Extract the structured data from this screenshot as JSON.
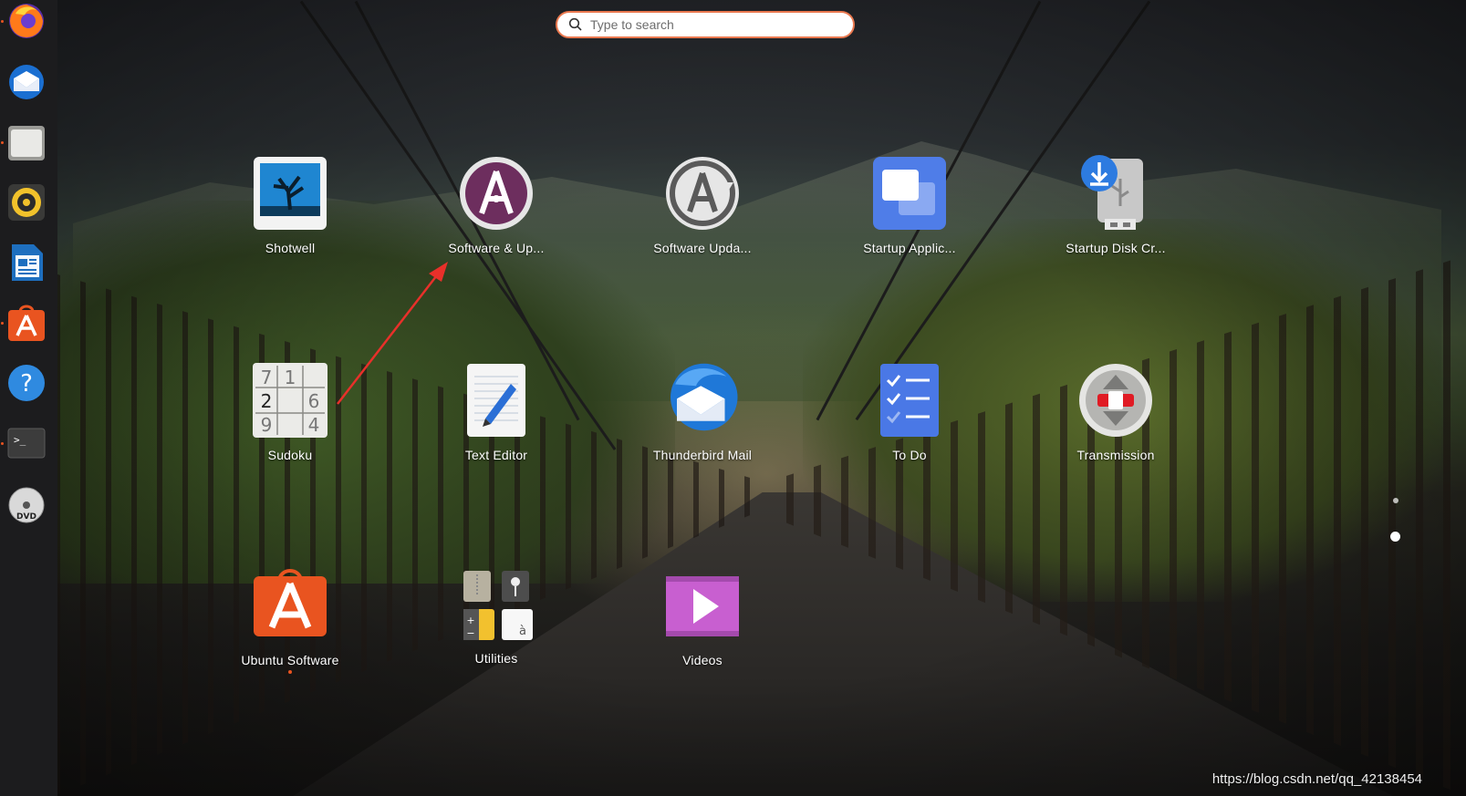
{
  "search": {
    "placeholder": "Type to search"
  },
  "dock": {
    "items": [
      {
        "icon": "firefox-icon",
        "running": true
      },
      {
        "icon": "thunderbird-icon",
        "running": false
      },
      {
        "icon": "files-icon",
        "running": true
      },
      {
        "icon": "rhythmbox-icon",
        "running": false
      },
      {
        "icon": "libreoffice-writer-icon",
        "running": false
      },
      {
        "icon": "ubuntu-software-icon",
        "running": true
      },
      {
        "icon": "help-icon",
        "running": false
      },
      {
        "icon": "terminal-icon",
        "running": true
      },
      {
        "icon": "dvd-icon",
        "running": false
      }
    ]
  },
  "apps": [
    {
      "label": "Shotwell",
      "icon": "shotwell-icon"
    },
    {
      "label": "Software & Up...",
      "icon": "software-properties-icon"
    },
    {
      "label": "Software Upda...",
      "icon": "software-updater-icon"
    },
    {
      "label": "Startup Applic...",
      "icon": "startup-applications-icon"
    },
    {
      "label": "Startup Disk Cr...",
      "icon": "startup-disk-creator-icon"
    },
    {
      "label": "Sudoku",
      "icon": "sudoku-icon",
      "digits": [
        "7",
        "1",
        "2",
        "6",
        "9",
        "4"
      ]
    },
    {
      "label": "Text Editor",
      "icon": "text-editor-icon"
    },
    {
      "label": "Thunderbird Mail",
      "icon": "thunderbird-icon"
    },
    {
      "label": "To Do",
      "icon": "todo-icon"
    },
    {
      "label": "Transmission",
      "icon": "transmission-icon"
    },
    {
      "label": "Ubuntu Software",
      "icon": "ubuntu-software-icon",
      "running": true
    },
    {
      "label": "Utilities",
      "icon": "utilities-folder-icon",
      "folder_glyph": "à"
    },
    {
      "label": "Videos",
      "icon": "videos-icon"
    }
  ],
  "pager": {
    "pages": 2,
    "current": 2
  },
  "colors": {
    "accent": "#E95420",
    "search_border": "#E9784F",
    "annotation_arrow": "#E8302A"
  },
  "watermark": "https://blog.csdn.net/qq_42138454"
}
